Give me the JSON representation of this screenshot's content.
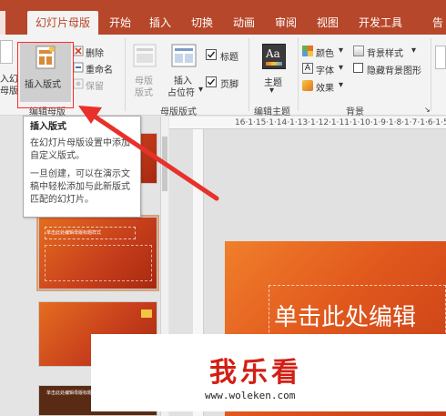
{
  "tabs": [
    {
      "label": "幻灯片母版",
      "active": true
    },
    {
      "label": "开始"
    },
    {
      "label": "插入"
    },
    {
      "label": "切换"
    },
    {
      "label": "动画"
    },
    {
      "label": "审阅"
    },
    {
      "label": "视图"
    },
    {
      "label": "开发工具"
    },
    {
      "label": "告"
    }
  ],
  "ribbon": {
    "insert_master_partial": "入幻",
    "insert_master_partial2": "母版",
    "insert_layout": "插入版式",
    "delete": "删除",
    "rename": "重命名",
    "preserve": "保留",
    "group_edit_master": "编辑母版",
    "master_layout": "母版",
    "master_layout2": "版式",
    "insert_placeholder": "插入",
    "insert_placeholder2": "占位符",
    "title_check": "标题",
    "footer_check": "页脚",
    "group_master_layout": "母版版式",
    "theme": "主题",
    "group_edit_theme": "编辑主题",
    "colors": "颜色",
    "fonts": "字体",
    "effects": "效果",
    "bg_styles": "背景样式",
    "hide_bg": "隐藏背景图形",
    "group_background": "背景",
    "theme_icon_text": "Aa"
  },
  "tooltip": {
    "title": "插入版式",
    "p1": "在幻灯片母版设置中添加自定义版式。",
    "p2": "一旦创建，可以在演示文稿中轻松添加与此新版式匹配的幻灯片。"
  },
  "ruler": {
    "text": "16·1·15·1·14·1·13·1·12·1·11·1·10·1·9·1·8·1·7·1·6·1·5"
  },
  "thumbnails": {
    "thumb2_title": "单击此处编辑母版标题样式",
    "thumb4_title": "单击此处编辑母版标题样式"
  },
  "slide": {
    "title": "单击此处编辑"
  },
  "watermark": {
    "text": "我乐看",
    "url": "www.woleken.com"
  },
  "colors": {
    "accent": "#b7472a",
    "slide": "#e1581d",
    "highlight": "#ff2a2a"
  },
  "icons": [
    "insert-layout-icon",
    "delete-icon",
    "rename-icon",
    "preserve-icon",
    "theme-icon",
    "colors-icon",
    "fonts-icon",
    "effects-icon",
    "bg-styles-icon",
    "checkbox-icon",
    "dialog-launcher-icon"
  ]
}
